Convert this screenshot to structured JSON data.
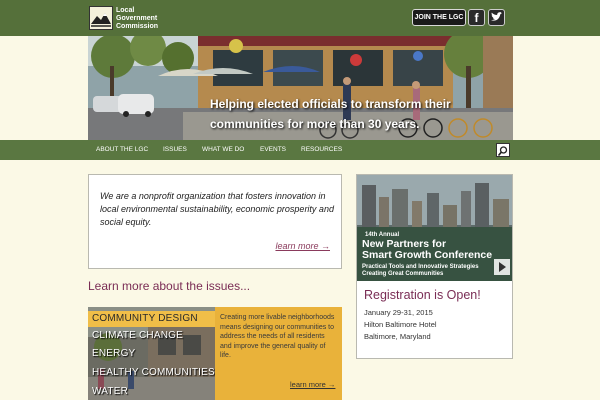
{
  "header": {
    "logo_lines": [
      "Local",
      "Government",
      "Commission"
    ],
    "join_label": "JOIN THE LGC",
    "facebook_label": "f"
  },
  "hero": {
    "caption_line1": "Helping elected officials to transform their",
    "caption_line2": "communities for more than 30 years."
  },
  "nav": {
    "items": [
      "ABOUT THE LGC",
      "ISSUES",
      "WHAT WE DO",
      "EVENTS",
      "RESOURCES"
    ]
  },
  "intro": {
    "text": "We are a nonprofit organization that fosters innovation in local environmental sustainability, economic prosperity and social equity.",
    "more_label": "learn more →"
  },
  "learn": {
    "heading": "Learn more about the issues..."
  },
  "issues": {
    "items": [
      "COMMUNITY DESIGN",
      "CLIMATE CHANGE",
      "ENERGY",
      "HEALTHY COMMUNITIES",
      "WATER"
    ],
    "active_index": 0,
    "description": "Creating more livable neighborhoods means designing our communities to address the needs of all residents and improve the general quality of life.",
    "more_label": "learn more →"
  },
  "conference": {
    "annual": "14th Annual",
    "title_line1": "New Partners for",
    "title_line2": "Smart Growth Conference",
    "subtitle_line1": "Practical Tools and Innovative Strategies",
    "subtitle_line2": "Creating Great Communities",
    "heading": "Registration is Open!",
    "date": "January 29-31, 2015",
    "venue": "Hilton Baltimore Hotel",
    "city": "Baltimore, Maryland"
  },
  "colors": {
    "header_green": "#55703a",
    "nav_green": "#5a7741",
    "accent_purple": "#7a2d55",
    "issues_yellow": "#e9b23a",
    "page_background": "#fbf9e6"
  },
  "icons": {
    "logo": "mountain-logo-icon",
    "facebook": "facebook-icon",
    "twitter": "twitter-icon",
    "search": "search-icon",
    "play": "play-icon"
  }
}
